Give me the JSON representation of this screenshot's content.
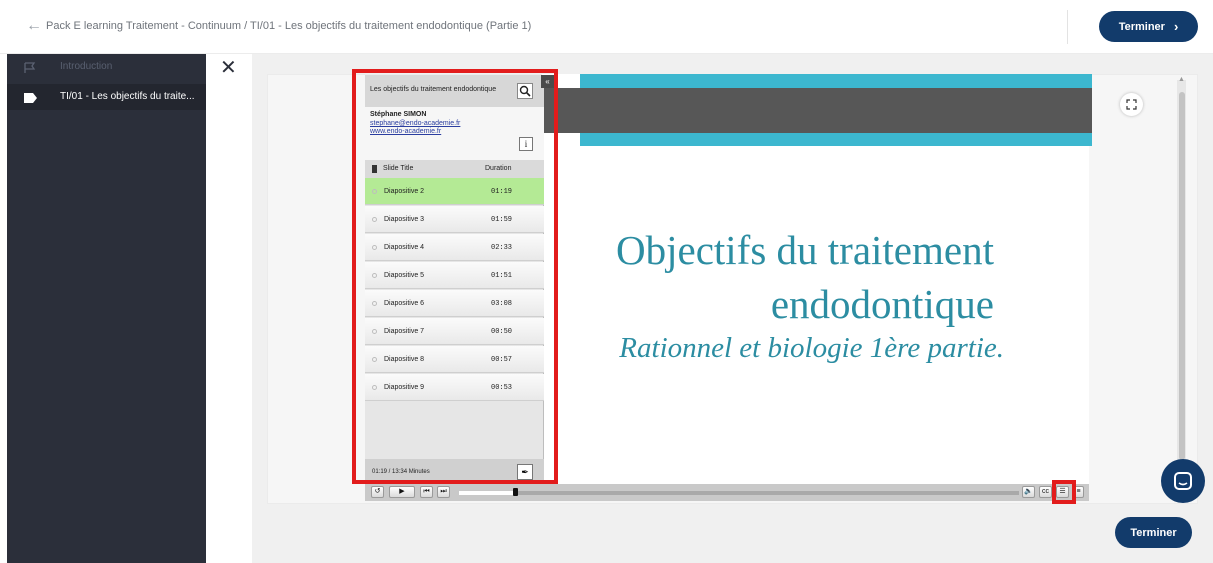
{
  "header": {
    "breadcrumb": "Pack E learning Traitement - Continuum / TI/01 - Les objectifs du traitement endodontique (Partie 1)",
    "finish_label": "Terminer"
  },
  "sidebar": {
    "items": [
      {
        "label": "Introduction",
        "active": false
      },
      {
        "label": "TI/01 - Les objectifs du traite...",
        "active": true
      }
    ]
  },
  "toc": {
    "title": "Les objectifs du traitement endodontique",
    "presenter_name": "Stéphane SIMON",
    "presenter_email": "stephane@endo-academie.fr",
    "presenter_site": "www.endo-academie.fr",
    "col_title": "Slide Title",
    "col_duration": "Duration",
    "slides": [
      {
        "title": "Diapositive 2",
        "duration": "01:19",
        "active": true
      },
      {
        "title": "Diapositive 3",
        "duration": "01:59",
        "active": false
      },
      {
        "title": "Diapositive 4",
        "duration": "02:33",
        "active": false
      },
      {
        "title": "Diapositive 5",
        "duration": "01:51",
        "active": false
      },
      {
        "title": "Diapositive 6",
        "duration": "03:08",
        "active": false
      },
      {
        "title": "Diapositive 7",
        "duration": "00:50",
        "active": false
      },
      {
        "title": "Diapositive 8",
        "duration": "00:57",
        "active": false
      },
      {
        "title": "Diapositive 9",
        "duration": "00:53",
        "active": false
      }
    ],
    "time": "01:19 / 13:34 Minutes"
  },
  "slide": {
    "title_line1": "Objectifs du traitement",
    "title_line2": "endodontique",
    "subtitle": "Rationnel et biologie 1ère partie."
  },
  "player": {
    "progress_fraction": 0.1
  },
  "colors": {
    "brand_navy": "#123b6b",
    "sidebar_bg": "#2b2f3a",
    "slide_text": "#2c8da2",
    "highlight_red": "#e21c1c",
    "active_slide_green": "#b4ea95"
  }
}
